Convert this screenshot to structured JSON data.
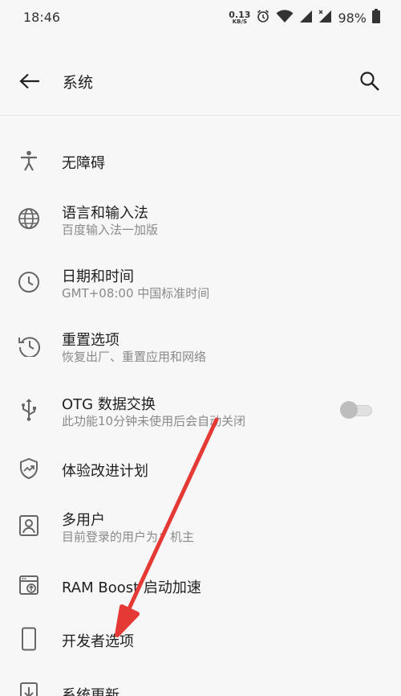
{
  "status_bar": {
    "time": "18:46",
    "net_speed_value": "0.13",
    "net_speed_unit": "KB/S",
    "battery": "98%",
    "icons": [
      "alarm-icon",
      "wifi-icon",
      "signal-icon",
      "signal-x-icon",
      "battery-icon"
    ]
  },
  "app_bar": {
    "title": "系统",
    "back_icon": "arrow-left-icon",
    "search_icon": "search-icon"
  },
  "items": [
    {
      "title": "无障碍",
      "subtitle": "",
      "icon": "accessibility-icon"
    },
    {
      "title": "语言和输入法",
      "subtitle": "百度输入法一加版",
      "icon": "globe-icon"
    },
    {
      "title": "日期和时间",
      "subtitle": "GMT+08:00 中国标准时间",
      "icon": "clock-icon"
    },
    {
      "title": "重置选项",
      "subtitle": "恢复出厂、重置应用和网络",
      "icon": "history-icon"
    },
    {
      "title": "OTG 数据交换",
      "subtitle": "此功能10分钟未使用后会自动关闭",
      "icon": "usb-icon",
      "toggle": "off"
    },
    {
      "title": "体验改进计划",
      "subtitle": "",
      "icon": "shield-trend-icon"
    },
    {
      "title": "多用户",
      "subtitle": "目前登录的用户为：机主",
      "icon": "user-icon"
    },
    {
      "title": "RAM Boost 启动加速",
      "subtitle": "",
      "icon": "ram-boost-icon"
    },
    {
      "title": "开发者选项",
      "subtitle": "",
      "icon": "phone-icon"
    },
    {
      "title": "系统更新",
      "subtitle": "",
      "icon": "download-icon"
    }
  ],
  "annotation": {
    "icon": "red-arrow-icon",
    "color": "#e53935"
  }
}
